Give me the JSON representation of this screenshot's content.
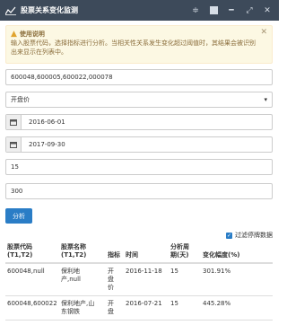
{
  "window": {
    "title": "股票关系变化监测",
    "controls": [
      "filter-icon",
      "minimize-icon",
      "maximize-icon",
      "expand-icon",
      "close-icon"
    ]
  },
  "alert": {
    "title": "使用说明",
    "body": "输入股票代码，选择指标进行分析。当相关性关系发生变化超过阈值时，其结果会被识别出来显示在列表中。",
    "icon": "warning-icon"
  },
  "form": {
    "stock_codes": "600048,600005,600022,000078",
    "indicator": "开盘价",
    "start_date": "2016-06-01",
    "end_date": "2017-09-30",
    "window": "15",
    "threshold": "300",
    "analyze_label": "分析",
    "filter_label": "过滤停牌数据",
    "filter_checked": true
  },
  "table": {
    "headers": [
      "股票代码\n(T1,T2)",
      "股票名称\n(T1,T2)",
      "指标",
      "时间",
      "分析周\n期(天)",
      "变化幅度(%)"
    ],
    "rows": [
      [
        "600048,null",
        "保利地\n产,null",
        "开\n盘\n价",
        "2016-11-18",
        "15",
        "301.91%"
      ],
      [
        "600048,600022",
        "保利地产,山\n东钢铁",
        "开\n盘",
        "2016-07-21",
        "15",
        "445.28%"
      ]
    ]
  },
  "colors": {
    "titlebar": "#3d4a5a",
    "accent": "#2a7dc6",
    "alert_bg": "#fcf8e3",
    "alert_text": "#8a6d3b"
  }
}
